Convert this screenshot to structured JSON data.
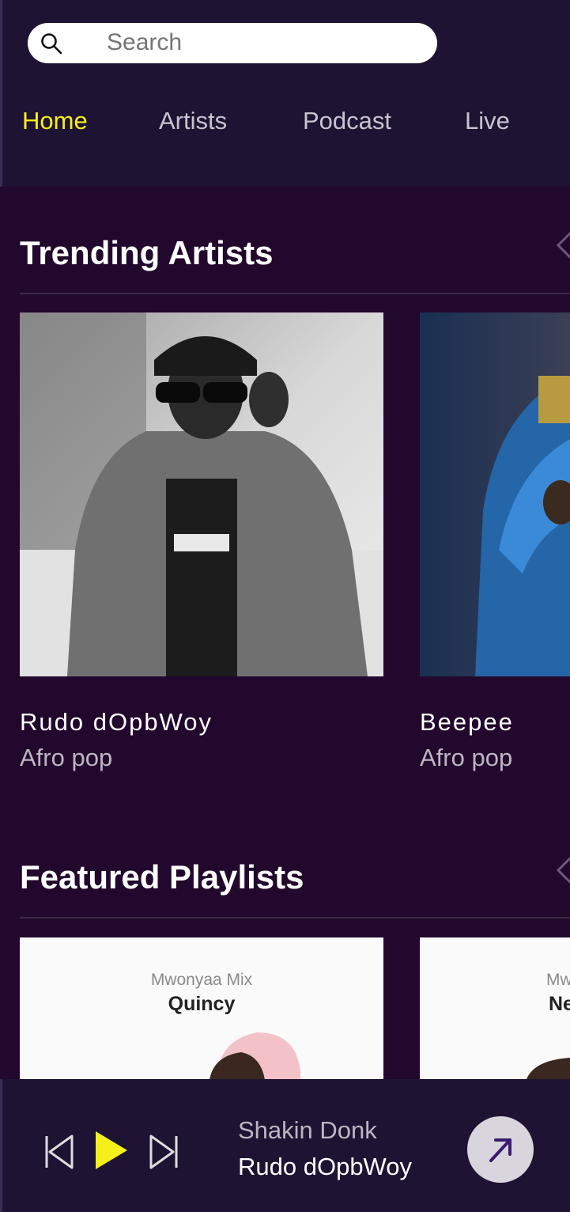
{
  "search": {
    "placeholder": "Search",
    "icon": "search-icon"
  },
  "nav": {
    "tabs": [
      {
        "label": "Home",
        "active": true
      },
      {
        "label": "Artists",
        "active": false
      },
      {
        "label": "Podcast",
        "active": false
      },
      {
        "label": "Live",
        "active": false
      }
    ],
    "active_color": "#f5f01a"
  },
  "trending": {
    "title": "Trending Artists",
    "artists": [
      {
        "name": "Rudo dOpbWoy",
        "genre": "Afro pop"
      },
      {
        "name": "Beepee",
        "genre": "Afro pop"
      }
    ]
  },
  "featured": {
    "title": "Featured Playlists",
    "playlists": [
      {
        "mix_label": "Mwonyaa Mix",
        "name": "Quincy"
      },
      {
        "mix_label": "Mw",
        "name": "Ne"
      }
    ]
  },
  "player": {
    "track_title": "Shakin Donk",
    "track_artist": "Rudo dOpbWoy",
    "play_color": "#f5f01a"
  }
}
